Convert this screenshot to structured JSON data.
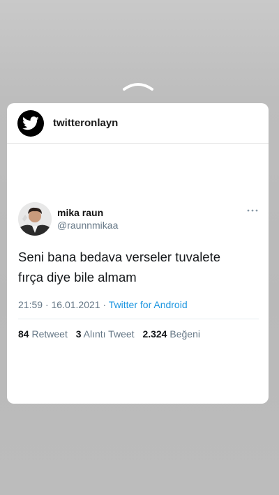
{
  "story": {
    "swipe_icon": "chevron-up-icon"
  },
  "header": {
    "logo_icon": "twitter-bird-icon",
    "account_name": "twitteronlayn"
  },
  "tweet": {
    "author_name": "mika raun",
    "author_handle": "@raunnmikaa",
    "text": "Seni bana bedava verseler tuvalete fırça diye bile almam",
    "time": "21:59",
    "separator": "·",
    "date": "16.01.2021",
    "source": "Twitter for Android",
    "stats": [
      {
        "count": "84",
        "label": "Retweet"
      },
      {
        "count": "3",
        "label": "Alıntı Tweet"
      },
      {
        "count": "2.324",
        "label": "Beğeni"
      }
    ]
  },
  "colors": {
    "link": "#1b95e0",
    "secondary_text": "#657786",
    "background": "#bdbdbd"
  }
}
